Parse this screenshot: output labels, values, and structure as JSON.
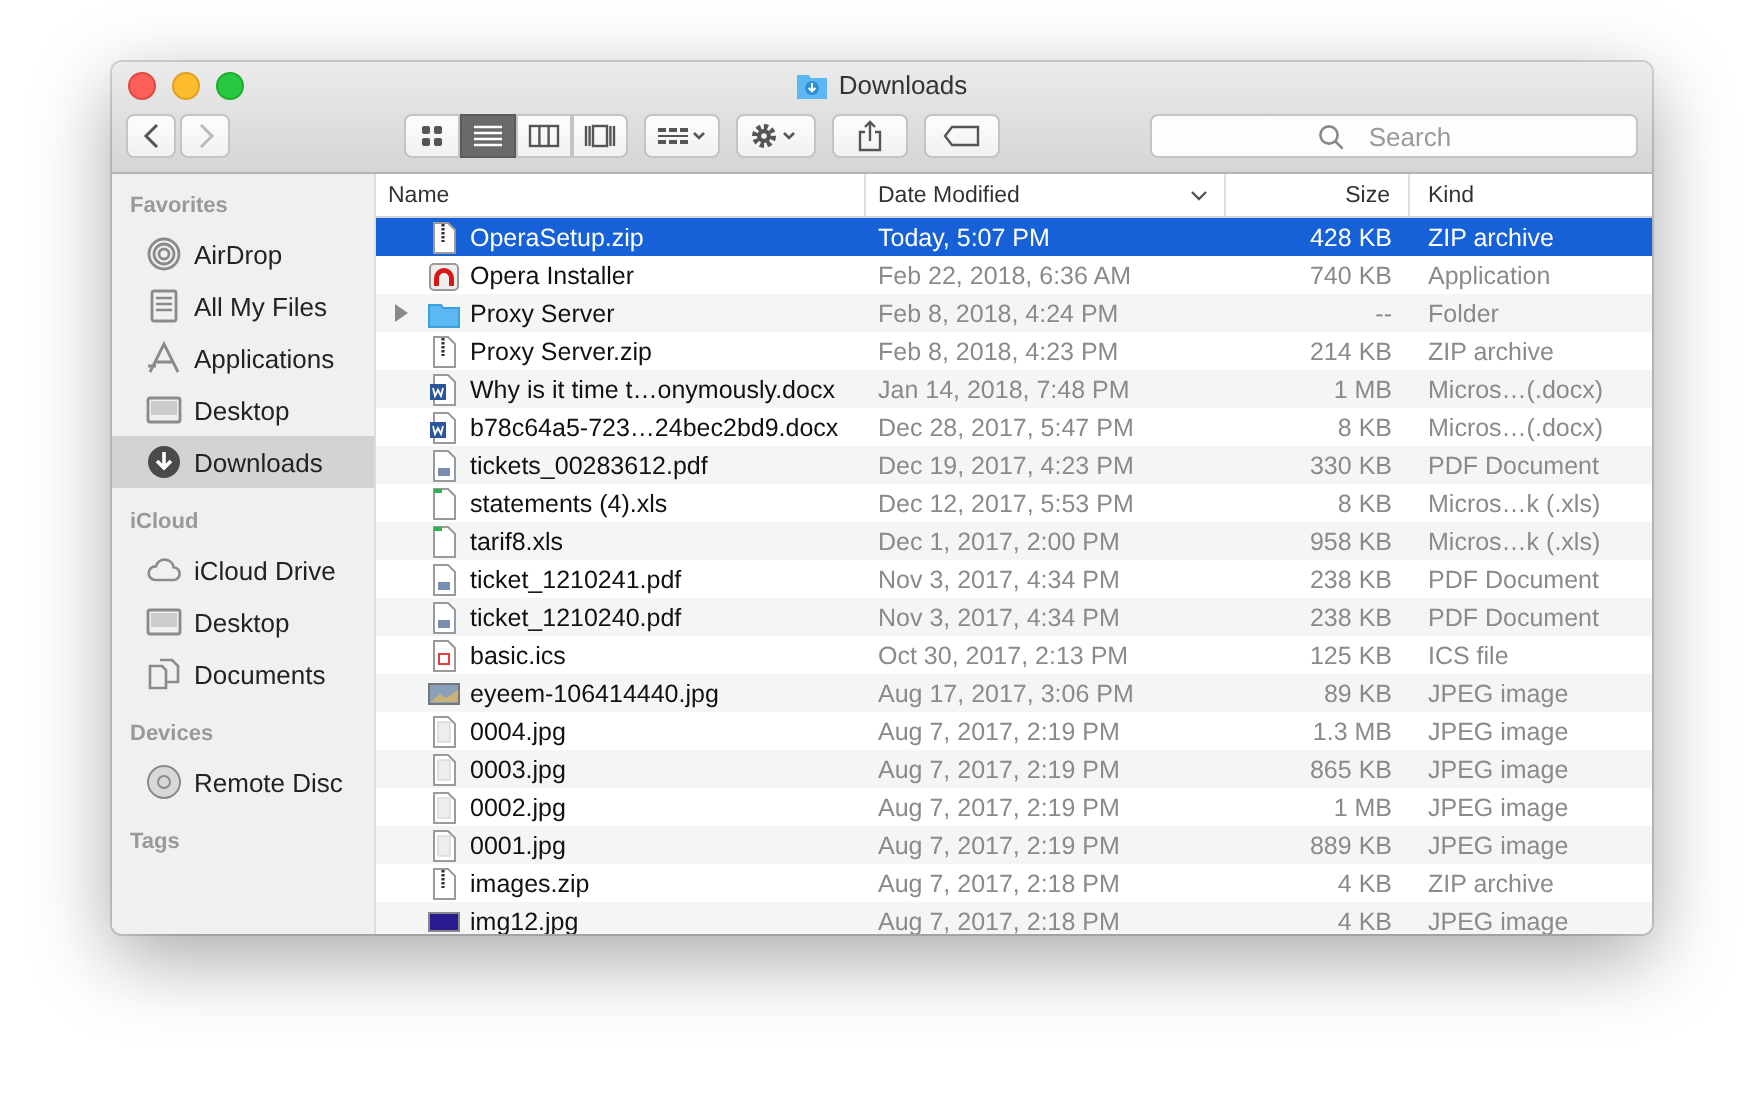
{
  "window": {
    "title": "Downloads"
  },
  "toolbar": {
    "back": {
      "disabled": false
    },
    "forward": {
      "disabled": true
    },
    "view_modes": [
      {
        "kind": "icons",
        "selected": false
      },
      {
        "kind": "list",
        "selected": true
      },
      {
        "kind": "columns",
        "selected": false
      },
      {
        "kind": "cover",
        "selected": false
      }
    ],
    "search": {
      "placeholder": "Search"
    }
  },
  "sidebar": {
    "sections": [
      {
        "title": "Favorites",
        "items": [
          {
            "label": "AirDrop",
            "kind": "airdrop",
            "selected": false
          },
          {
            "label": "All My Files",
            "kind": "files",
            "selected": false
          },
          {
            "label": "Applications",
            "kind": "apps",
            "selected": false
          },
          {
            "label": "Desktop",
            "kind": "desktop",
            "selected": false
          },
          {
            "label": "Downloads",
            "kind": "downloads",
            "selected": true
          }
        ]
      },
      {
        "title": "iCloud",
        "items": [
          {
            "label": "iCloud Drive",
            "kind": "cloud",
            "selected": false
          },
          {
            "label": "Desktop",
            "kind": "desktop",
            "selected": false
          },
          {
            "label": "Documents",
            "kind": "documents",
            "selected": false
          }
        ]
      },
      {
        "title": "Devices",
        "items": [
          {
            "label": "Remote Disc",
            "kind": "disc",
            "selected": false
          }
        ]
      },
      {
        "title": "Tags"
      }
    ]
  },
  "table": {
    "columns": [
      "Name",
      "Date Modified",
      "Size",
      "Kind"
    ],
    "rows": [
      {
        "name": "OperaSetup.zip",
        "date": "Today, 5:07 PM",
        "size": "428 KB",
        "file_kind": "ZIP archive",
        "kind": "zip",
        "selected": true
      },
      {
        "name": "Opera Installer",
        "date": "Feb 22, 2018, 6:36 AM",
        "size": "740 KB",
        "file_kind": "Application",
        "kind": "app",
        "selected": false
      },
      {
        "name": "Proxy Server",
        "date": "Feb 8, 2018, 4:24 PM",
        "size": "--",
        "file_kind": "Folder",
        "kind": "folder",
        "expanded": false,
        "selected": false
      },
      {
        "name": "Proxy Server.zip",
        "date": "Feb 8, 2018, 4:23 PM",
        "size": "214 KB",
        "file_kind": "ZIP archive",
        "kind": "zip",
        "selected": false
      },
      {
        "name": "Why is it time t…onymously.docx",
        "date": "Jan 14, 2018, 7:48 PM",
        "size": "1 MB",
        "file_kind": "Micros…(.docx)",
        "kind": "word",
        "selected": false
      },
      {
        "name": "b78c64a5-723…24bec2bd9.docx",
        "date": "Dec 28, 2017, 5:47 PM",
        "size": "8 KB",
        "file_kind": "Micros…(.docx)",
        "kind": "word",
        "selected": false
      },
      {
        "name": "tickets_00283612.pdf",
        "date": "Dec 19, 2017, 4:23 PM",
        "size": "330 KB",
        "file_kind": "PDF Document",
        "kind": "pdf",
        "selected": false
      },
      {
        "name": "statements (4).xls",
        "date": "Dec 12, 2017, 5:53 PM",
        "size": "8 KB",
        "file_kind": "Micros…k (.xls)",
        "kind": "sheet",
        "selected": false
      },
      {
        "name": "tarif8.xls",
        "date": "Dec 1, 2017, 2:00 PM",
        "size": "958 KB",
        "file_kind": "Micros…k (.xls)",
        "kind": "sheet",
        "selected": false
      },
      {
        "name": "ticket_1210241.pdf",
        "date": "Nov 3, 2017, 4:34 PM",
        "size": "238 KB",
        "file_kind": "PDF Document",
        "kind": "pdf",
        "selected": false
      },
      {
        "name": "ticket_1210240.pdf",
        "date": "Nov 3, 2017, 4:34 PM",
        "size": "238 KB",
        "file_kind": "PDF Document",
        "kind": "pdf",
        "selected": false
      },
      {
        "name": "basic.ics",
        "date": "Oct 30, 2017, 2:13 PM",
        "size": "125 KB",
        "file_kind": "ICS file",
        "kind": "calendar",
        "selected": false
      },
      {
        "name": "eyeem-106414440.jpg",
        "date": "Aug 17, 2017, 3:06 PM",
        "size": "89 KB",
        "file_kind": "JPEG image",
        "kind": "photo",
        "selected": false
      },
      {
        "name": "0004.jpg",
        "date": "Aug 7, 2017, 2:19 PM",
        "size": "1.3 MB",
        "file_kind": "JPEG image",
        "kind": "page",
        "selected": false
      },
      {
        "name": "0003.jpg",
        "date": "Aug 7, 2017, 2:19 PM",
        "size": "865 KB",
        "file_kind": "JPEG image",
        "kind": "page",
        "selected": false
      },
      {
        "name": "0002.jpg",
        "date": "Aug 7, 2017, 2:19 PM",
        "size": "1 MB",
        "file_kind": "JPEG image",
        "kind": "page",
        "selected": false
      },
      {
        "name": "0001.jpg",
        "date": "Aug 7, 2017, 2:19 PM",
        "size": "889 KB",
        "file_kind": "JPEG image",
        "kind": "page",
        "selected": false
      },
      {
        "name": "images.zip",
        "date": "Aug 7, 2017, 2:18 PM",
        "size": "4 KB",
        "file_kind": "ZIP archive",
        "kind": "zip",
        "selected": false
      },
      {
        "name": "img12.jpg",
        "date": "Aug 7, 2017, 2:18 PM",
        "size": "4 KB",
        "file_kind": "JPEG image",
        "kind": "swatch",
        "selected": false
      }
    ]
  }
}
